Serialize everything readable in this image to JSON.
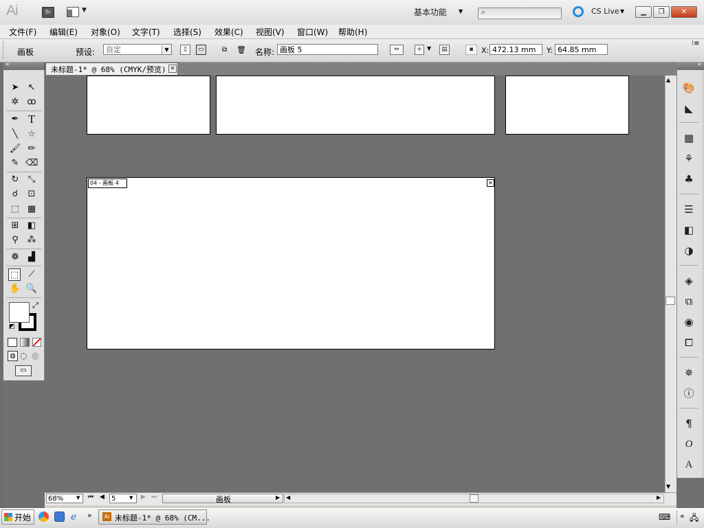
{
  "app": {
    "logo": "Ai",
    "bridge": "Br",
    "workspace": "基本功能",
    "cslive": "CS Live"
  },
  "menu": [
    "文件(F)",
    "编辑(E)",
    "对象(O)",
    "文字(T)",
    "选择(S)",
    "效果(C)",
    "视图(V)",
    "窗口(W)",
    "帮助(H)"
  ],
  "control": {
    "mode_label": "画板",
    "preset_label": "预设:",
    "preset_value": "自定",
    "name_label": "名称:",
    "name_value": "画板 5",
    "x_label": "X:",
    "x_value": "472.13 mm",
    "y_label": "Y:",
    "y_value": "64.85 mm"
  },
  "document": {
    "tab_title": "未标题-1* @ 68% (CMYK/预览)"
  },
  "artboards": {
    "active_label": "04 - 画板 4"
  },
  "status": {
    "zoom": "68%",
    "page": "5",
    "tool_label": "画板"
  },
  "taskbar": {
    "start": "开始",
    "item": "未标题-1* @ 68% (CM..."
  }
}
